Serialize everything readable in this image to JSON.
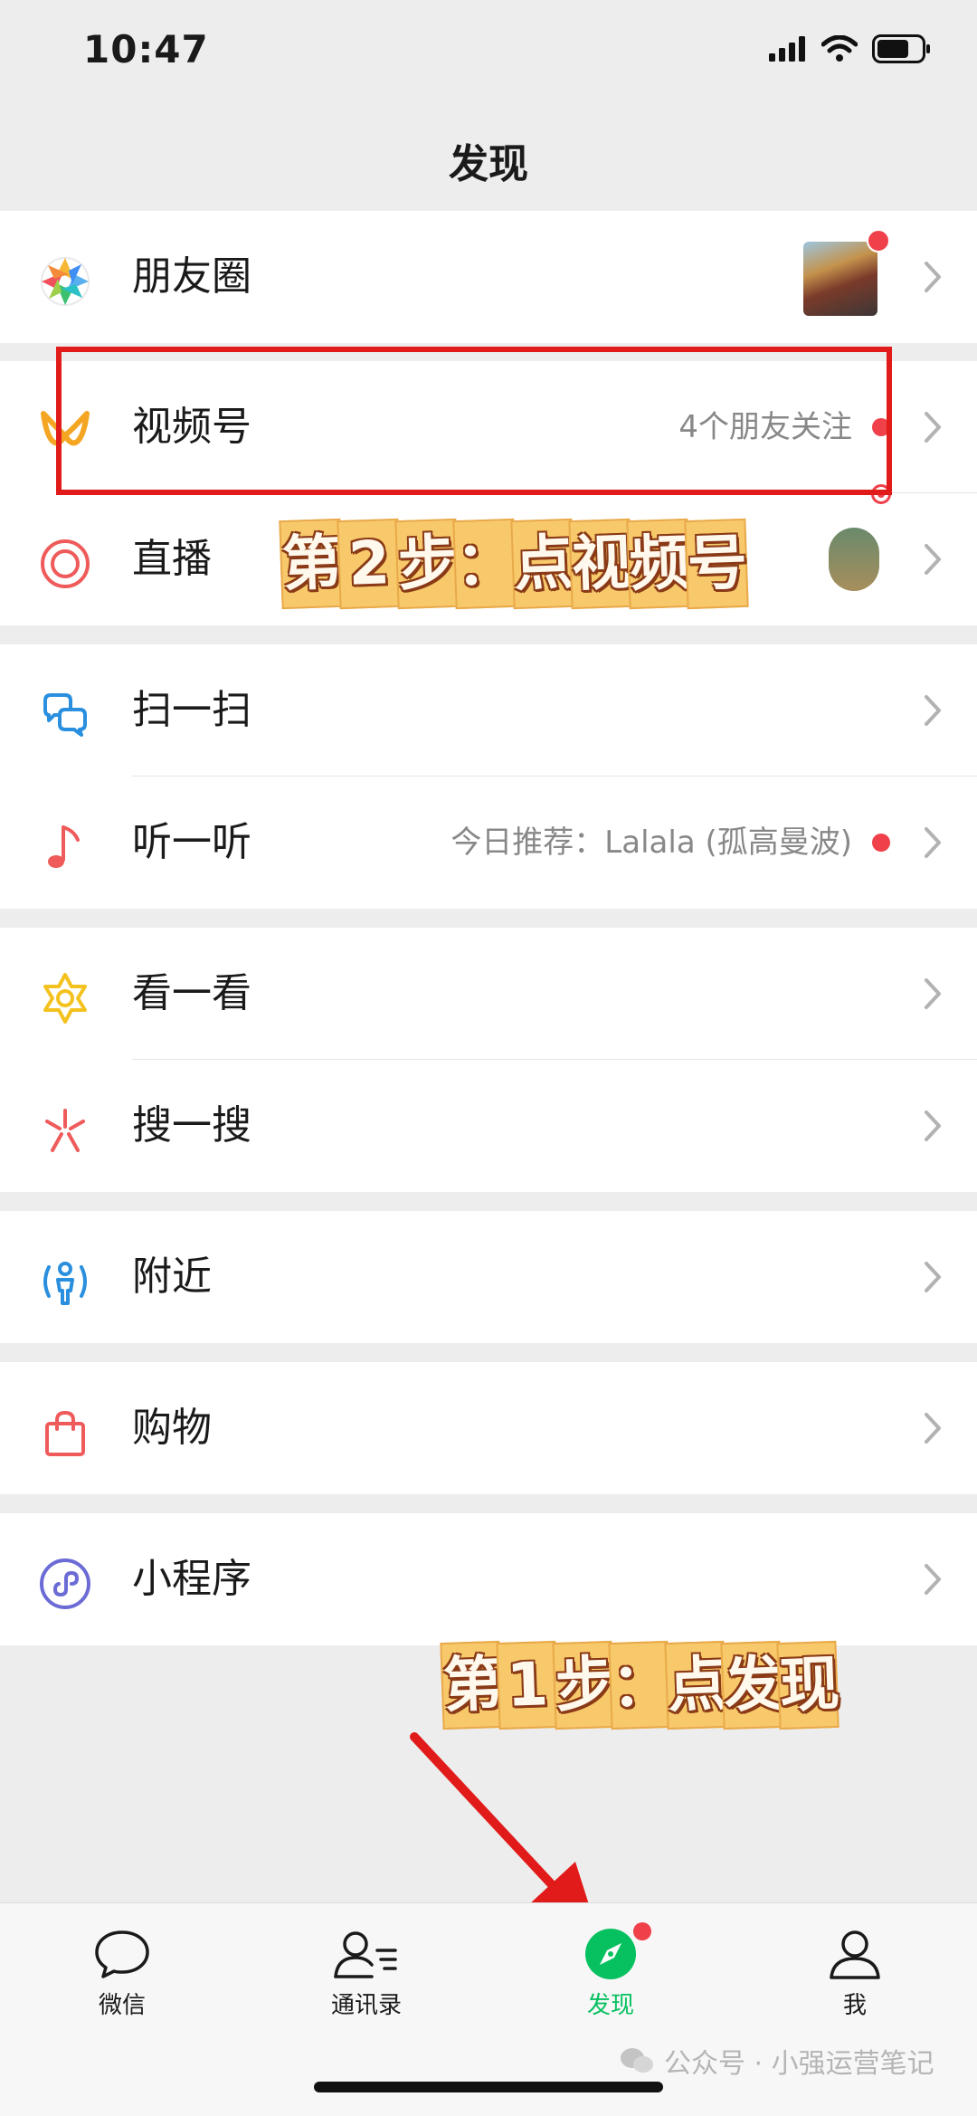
{
  "status_bar": {
    "time": "10:47"
  },
  "nav": {
    "title": "发现"
  },
  "cells": {
    "moments": {
      "label": "朋友圈",
      "icon": "moments-aperture-icon"
    },
    "channels": {
      "label": "视频号",
      "detail": "4个朋友关注",
      "icon": "channels-icon"
    },
    "live": {
      "label": "直播",
      "icon": "live-icon"
    },
    "scan": {
      "label": "扫一扫",
      "icon": "scan-icon"
    },
    "listen": {
      "label": "听一听",
      "detail": "今日推荐：Lalala (孤高曼波)",
      "icon": "music-note-icon"
    },
    "topstories": {
      "label": "看一看",
      "icon": "top-stories-icon"
    },
    "search": {
      "label": "搜一搜",
      "icon": "search-star-icon"
    },
    "nearby": {
      "label": "附近",
      "icon": "nearby-icon"
    },
    "shopping": {
      "label": "购物",
      "icon": "shopping-bag-icon"
    },
    "miniprograms": {
      "label": "小程序",
      "icon": "mini-program-icon"
    }
  },
  "annotations": {
    "step2": [
      "第",
      "2",
      "步",
      "：",
      "点",
      "视",
      "频",
      "号"
    ],
    "step1": [
      "第",
      "1",
      "步",
      "：",
      "点",
      "发",
      "现"
    ]
  },
  "tabbar": {
    "items": [
      {
        "label": "微信",
        "icon": "chat-bubble-icon",
        "active": false
      },
      {
        "label": "通讯录",
        "icon": "contacts-icon",
        "active": false
      },
      {
        "label": "发现",
        "icon": "discover-compass-icon",
        "active": true
      },
      {
        "label": "我",
        "icon": "me-person-icon",
        "active": false
      }
    ]
  },
  "watermark": {
    "text": "公众号 · 小强运营笔记"
  },
  "colors": {
    "accent": "#07c160",
    "badge": "#f0404a",
    "annotation_border": "#e11a1a",
    "background": "#ededed"
  }
}
